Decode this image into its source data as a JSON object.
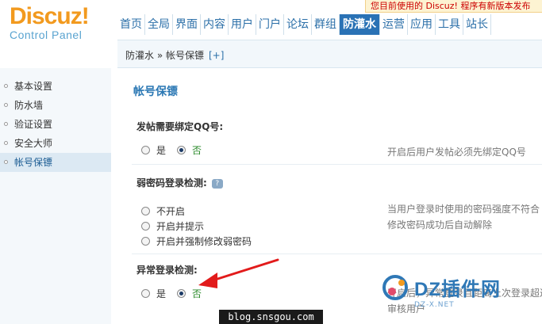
{
  "header": {
    "logo_text": "Discuz!",
    "logo_sub": "Control Panel",
    "notice": "您目前使用的 Discuz! 程序有新版本发布",
    "nav": [
      "首页",
      "全局",
      "界面",
      "内容",
      "用户",
      "门户",
      "论坛",
      "群组",
      "防灌水",
      "运营",
      "应用",
      "工具",
      "站长"
    ],
    "active_nav": "防灌水"
  },
  "breadcrumb": {
    "path": "防灌水 » 帐号保镖",
    "add": "[+]"
  },
  "sidebar": {
    "items": [
      "基本设置",
      "防水墙",
      "验证设置",
      "安全大师",
      "帐号保镖"
    ],
    "active": "帐号保镖"
  },
  "main": {
    "title": "帐号保镖",
    "settings": [
      {
        "label": "发帖需要绑定QQ号:",
        "options": [
          "是",
          "否"
        ],
        "selected": "否",
        "description": "开启后用户发帖必须先绑定QQ号"
      },
      {
        "label": "弱密码登录检测:",
        "options": [
          "不开启",
          "开启并提示",
          "开启并强制修改弱密码"
        ],
        "selected": "",
        "description_lines": [
          "当用户登录时使用的密码强度不符合",
          "修改密码成功后自动解除"
        ]
      },
      {
        "label": "异常登录检测:",
        "options": [
          "是",
          "否"
        ],
        "selected": "否",
        "description_lines": [
          "开启后，异常登录且距离上次登录超过",
          "审核用户"
        ]
      }
    ]
  },
  "watermarks": {
    "blog": "blog.snsgou.com",
    "dz_text": "DZ插件网",
    "dz_url": "DZ-X.NET"
  },
  "colors": {
    "brand_orange": "#f29a1f",
    "nav_active": "#2a72b5",
    "arrow_red": "#e21b1b",
    "title_blue": "#2b78b4"
  }
}
